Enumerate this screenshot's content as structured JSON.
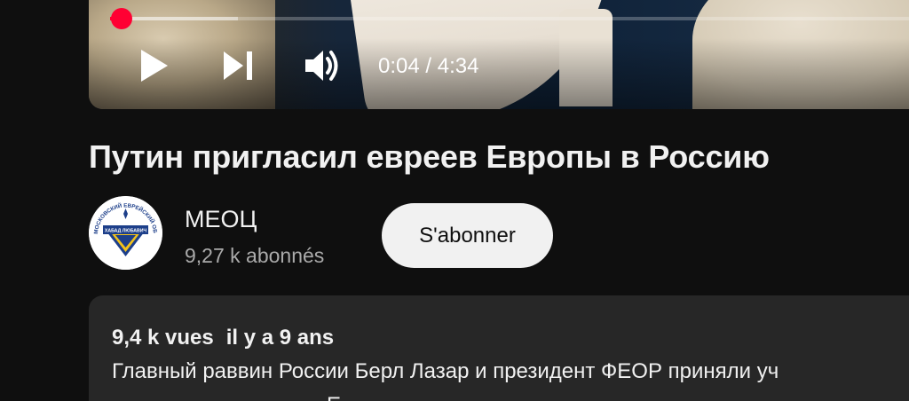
{
  "player": {
    "current_time": "0:04",
    "separator": " / ",
    "duration": "4:34",
    "progress_fraction": 0.0146,
    "buffered_fraction": 0.16,
    "accent_color": "#ff0033",
    "icons": {
      "play": "play-icon",
      "next": "next-icon",
      "volume": "volume-icon"
    }
  },
  "video": {
    "title": "Путин пригласил евреев Европы в Россию"
  },
  "channel": {
    "name": "МЕОЦ",
    "subscribers": "9,27 k abonnés",
    "subscribe_label": "S'abonner",
    "avatar_icon": "meots-logo-icon",
    "avatar_ring_text": "МОСКОВСКИЙ ЕВРЕЙСКИЙ ОБЩИННЫЙ ЦЕНТР",
    "avatar_badge_text": "ХАБАД ЛЮБАВИЧ"
  },
  "description": {
    "views": "9,4 k vues",
    "date": "il y a 9 ans",
    "text": "Главный раввин России Берл Лазар и президент ФЕОР приняли уч",
    "text_line2": "Е"
  }
}
